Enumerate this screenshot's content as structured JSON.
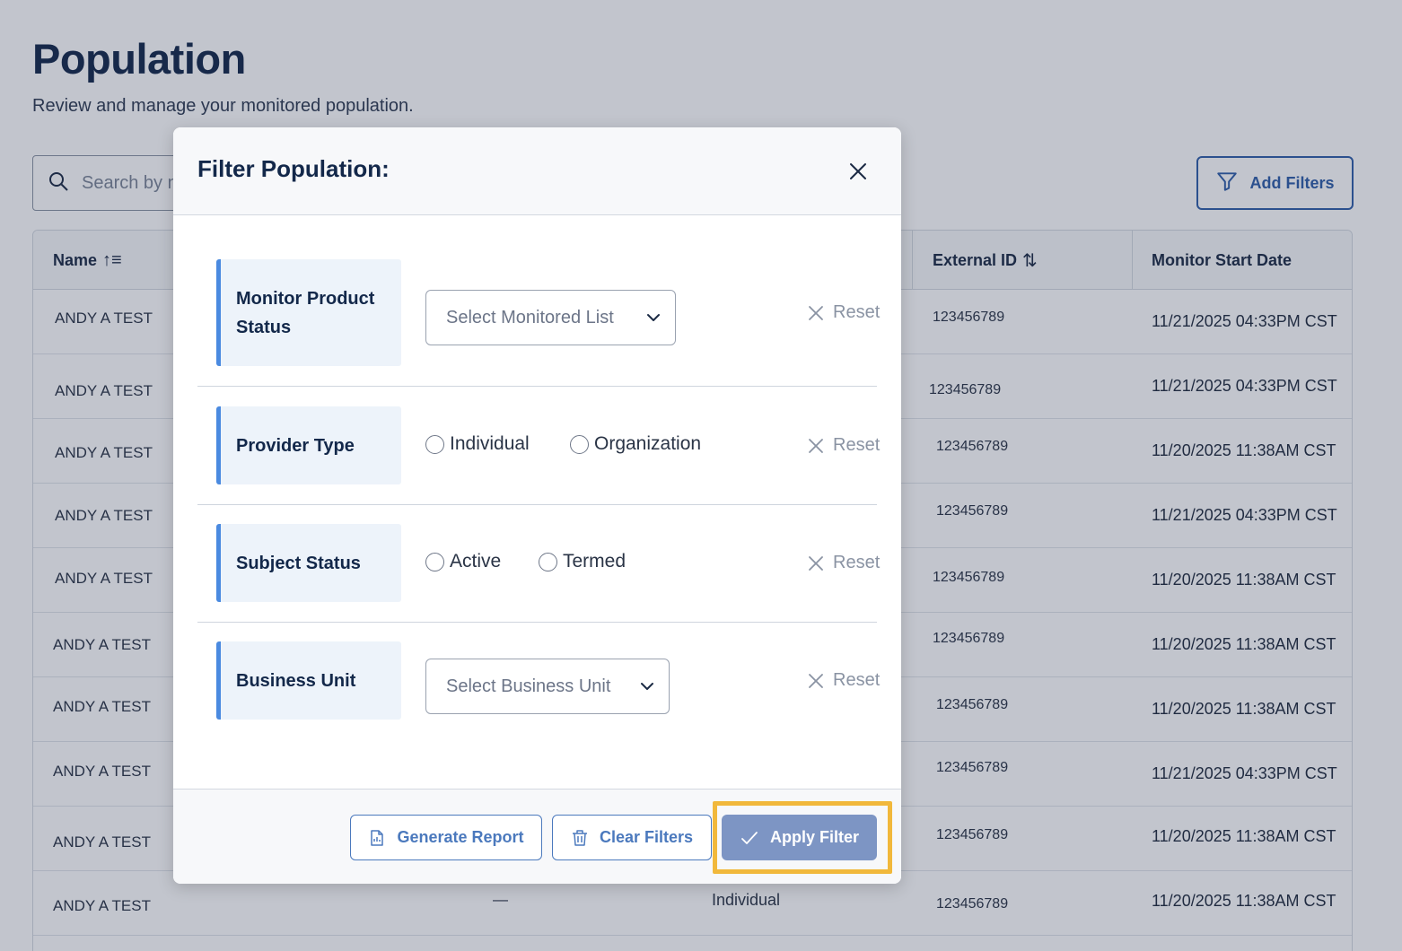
{
  "page": {
    "title": "Population",
    "subtitle": "Review and manage your monitored population.",
    "search_placeholder": "Search by name",
    "add_filters_label": "Add Filters"
  },
  "table": {
    "columns": {
      "name": "Name",
      "external_id": "External ID",
      "monitor_start_date": "Monitor Start Date"
    },
    "rows": [
      {
        "name": "ANDY A TEST",
        "external_id": "123456789",
        "date": "11/21/2025 04:33PM CST"
      },
      {
        "name": "ANDY A TEST",
        "external_id": "123456789",
        "date": "11/21/2025 04:33PM CST"
      },
      {
        "name": "ANDY A TEST",
        "external_id": "123456789",
        "date": "11/20/2025 11:38AM CST"
      },
      {
        "name": "ANDY A TEST",
        "external_id": "123456789",
        "date": "11/21/2025 04:33PM CST"
      },
      {
        "name": "ANDY A TEST",
        "external_id": "123456789",
        "date": "11/20/2025 11:38AM CST"
      },
      {
        "name": "ANDY A TEST",
        "external_id": "123456789",
        "date": "11/20/2025 11:38AM CST"
      },
      {
        "name": "ANDY A TEST",
        "external_id": "123456789",
        "date": "11/20/2025 11:38AM CST"
      },
      {
        "name": "ANDY A TEST",
        "external_id": "123456789",
        "date": "11/21/2025 04:33PM CST"
      },
      {
        "name": "ANDY A TEST",
        "external_id": "123456789",
        "date": "11/20/2025 11:38AM CST"
      },
      {
        "name": "ANDY A TEST",
        "external_id": "123456789",
        "date": "11/20/2025 11:38AM CST",
        "dash": "—",
        "provider_type": "Individual"
      }
    ]
  },
  "modal": {
    "title": "Filter Population:",
    "filters": {
      "monitor_product_status": {
        "label": "Monitor Product Status",
        "select_placeholder": "Select Monitored List",
        "reset": "Reset"
      },
      "provider_type": {
        "label": "Provider Type",
        "options": [
          "Individual",
          "Organization"
        ],
        "reset": "Reset"
      },
      "subject_status": {
        "label": "Subject Status",
        "options": [
          "Active",
          "Termed"
        ],
        "reset": "Reset"
      },
      "business_unit": {
        "label": "Business Unit",
        "select_placeholder": "Select Business Unit",
        "reset": "Reset"
      }
    },
    "footer": {
      "generate_report": "Generate Report",
      "clear_filters": "Clear Filters",
      "apply_filter": "Apply Filter"
    }
  },
  "colors": {
    "accent": "#2f5ea8",
    "apply_button": "#7d95c4",
    "highlight": "#f1b83b",
    "label_bar": "#4a8ae0"
  }
}
